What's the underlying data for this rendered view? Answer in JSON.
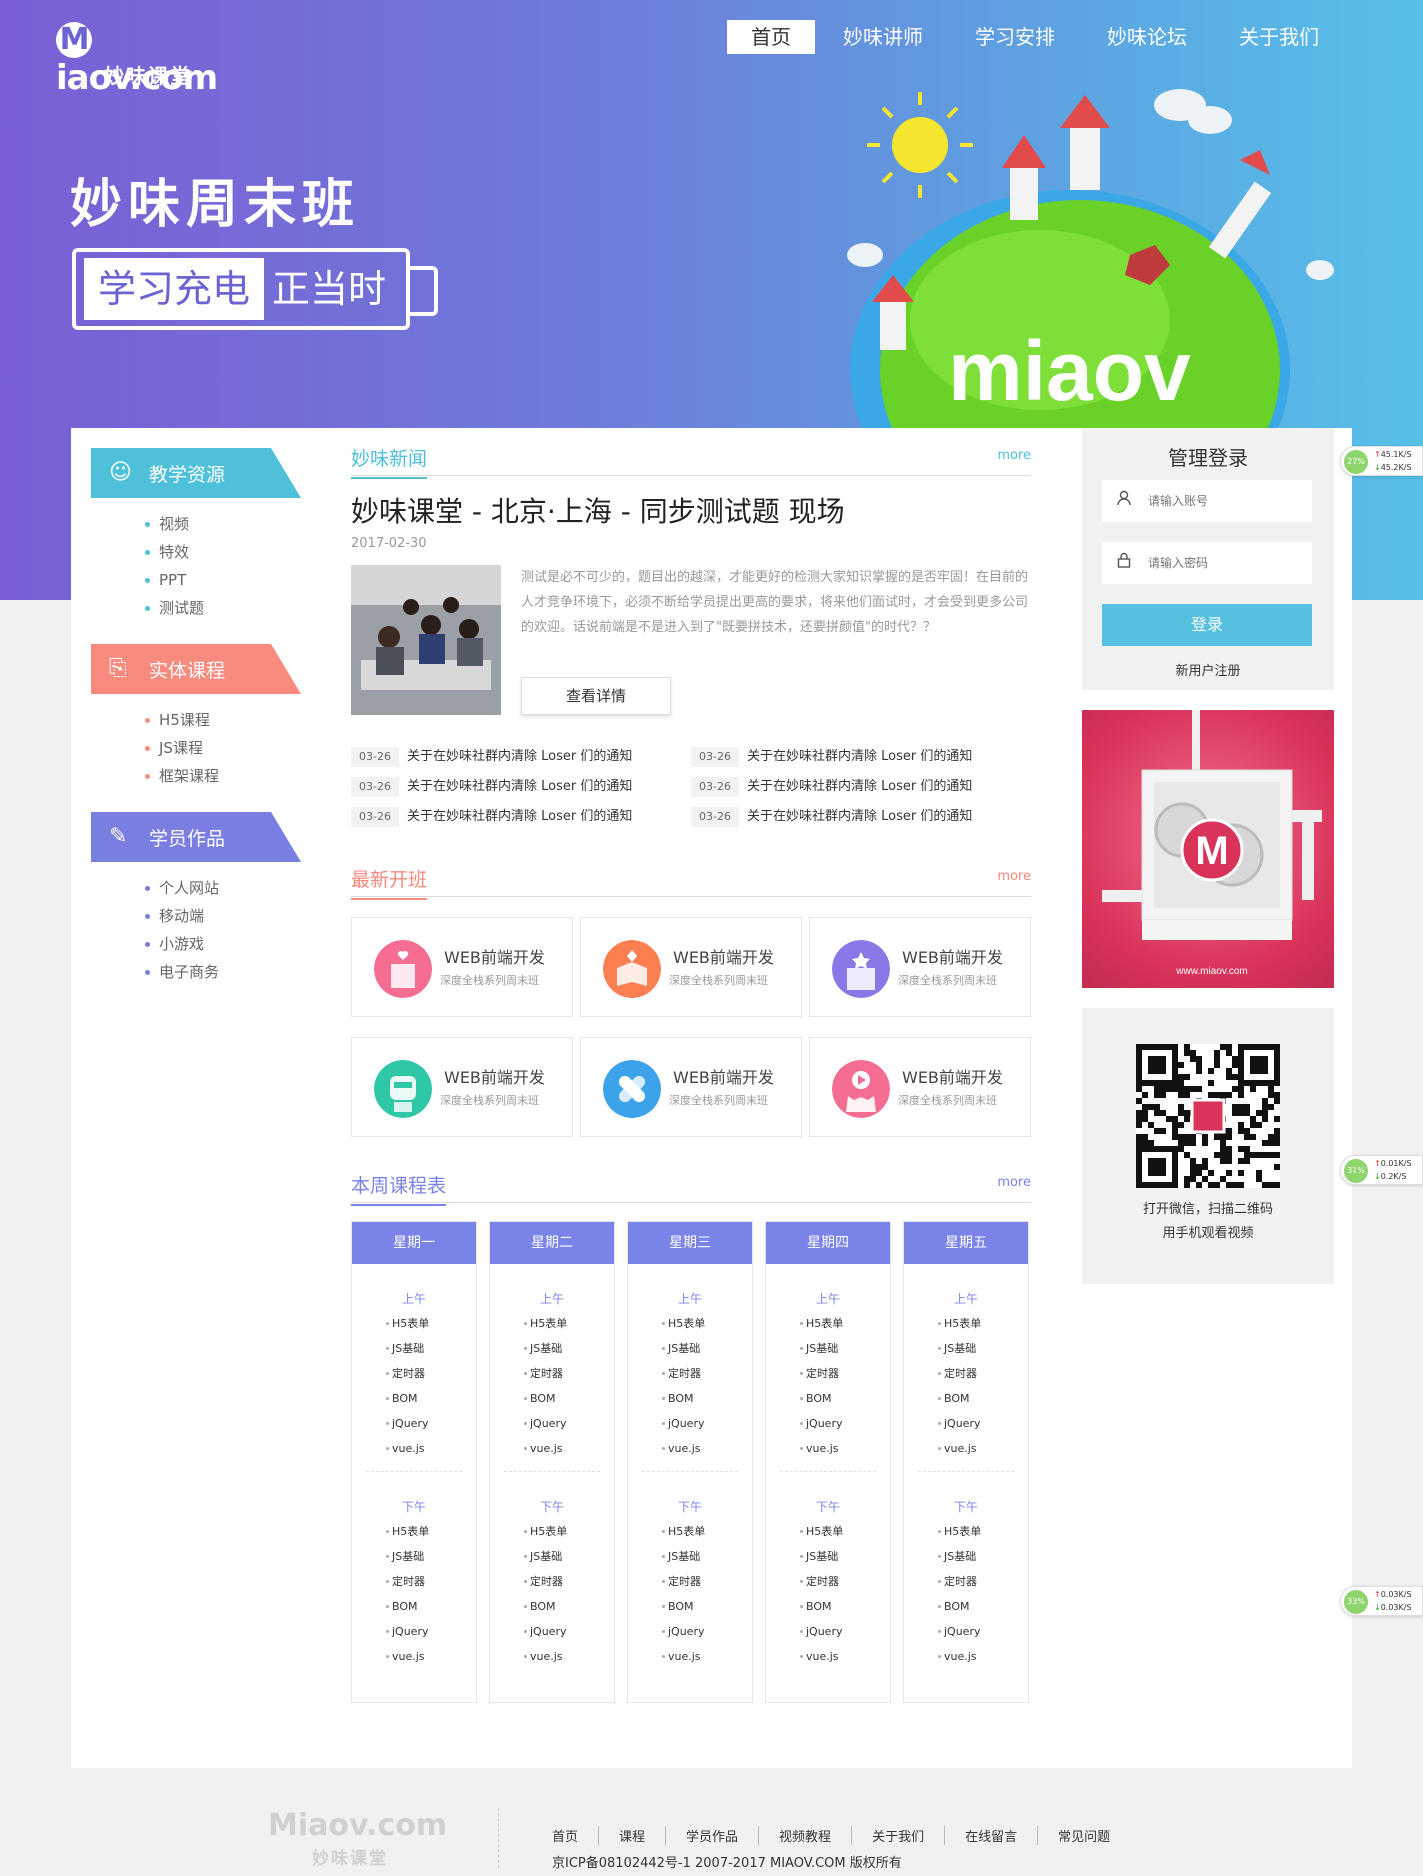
{
  "logo": {
    "main": "iaov.com",
    "m": "M",
    "sub": "妙味课堂"
  },
  "nav": [
    "首页",
    "妙味讲师",
    "学习安排",
    "妙味论坛",
    "关于我们"
  ],
  "hero": {
    "title": "妙味周末班",
    "box_highlight": "学习充电",
    "box_rest": "正当时",
    "planet_text": "miaov"
  },
  "left": {
    "cats": [
      {
        "label": "教学资源",
        "icon": "☺",
        "color": "#4fc0d9",
        "dot": "#4fc0d9",
        "items": [
          "视频",
          "特效",
          "PPT",
          "测试题"
        ]
      },
      {
        "label": "实体课程",
        "icon": "⎘",
        "color": "#f88a7e",
        "dot": "#f88a7e",
        "items": [
          "H5课程",
          "JS课程",
          "框架课程"
        ]
      },
      {
        "label": "学员作品",
        "icon": "✎",
        "color": "#7a7ee0",
        "dot": "#7a7ee0",
        "items": [
          "个人网站",
          "移动端",
          "小游戏",
          "电子商务"
        ]
      }
    ]
  },
  "news": {
    "section": "妙味新闻",
    "more": "more",
    "title": "妙味课堂 - 北京·上海 - 同步测试题 现场",
    "date": "2017-02-30",
    "summary": "测试是必不可少的，题目出的越深，才能更好的检测大家知识掌握的是否牢固！在目前的人才竞争环境下，必须不断给学员提出更高的要求，将来他们面试时，才会受到更多公司的欢迎。话说前端是不是进入到了\"既要拼技术，还要拼颜值\"的时代？？",
    "button": "查看详情",
    "list": [
      {
        "date": "03-26",
        "title": "关于在妙味社群内清除 Loser 们的通知"
      },
      {
        "date": "03-26",
        "title": "关于在妙味社群内清除 Loser 们的通知"
      },
      {
        "date": "03-26",
        "title": "关于在妙味社群内清除 Loser 们的通知"
      },
      {
        "date": "03-26",
        "title": "关于在妙味社群内清除 Loser 们的通知"
      },
      {
        "date": "03-26",
        "title": "关于在妙味社群内清除 Loser 们的通知"
      },
      {
        "date": "03-26",
        "title": "关于在妙味社群内清除 Loser 们的通知"
      }
    ]
  },
  "classes": {
    "section": "最新开班",
    "more": "more",
    "items": [
      {
        "title": "WEB前端开发",
        "sub": "深度全栈系列周末班",
        "color": "#f56d91"
      },
      {
        "title": "WEB前端开发",
        "sub": "深度全栈系列周末班",
        "color": "#fb7f51"
      },
      {
        "title": "WEB前端开发",
        "sub": "深度全栈系列周末班",
        "color": "#8a78e8"
      },
      {
        "title": "WEB前端开发",
        "sub": "深度全栈系列周末班",
        "color": "#2fc8a7"
      },
      {
        "title": "WEB前端开发",
        "sub": "深度全栈系列周末班",
        "color": "#3ca2ea"
      },
      {
        "title": "WEB前端开发",
        "sub": "深度全栈系列周末班",
        "color": "#f56d91"
      }
    ]
  },
  "schedule": {
    "section": "本周课程表",
    "more": "more",
    "days": [
      "星期一",
      "星期二",
      "星期三",
      "星期四",
      "星期五"
    ],
    "am": "上午",
    "pm": "下午",
    "topics": [
      "H5表单",
      "JS基础",
      "定时器",
      "BOM",
      "jQuery",
      "vue.js"
    ]
  },
  "login": {
    "title": "管理登录",
    "user_placeholder": "请输入账号",
    "pass_placeholder": "请输入密码",
    "button": "登录",
    "register": "新用户注册"
  },
  "ad": {
    "site": "www.miaov.com",
    "letter": "M"
  },
  "qr": {
    "line1": "打开微信，扫描二维码",
    "line2": "用手机观看视频"
  },
  "speed": [
    {
      "pct": "27%",
      "up": "45.1K/S",
      "down": "45.2K/S"
    },
    {
      "pct": "31%",
      "up": "0.01K/S",
      "down": "0.2K/S"
    },
    {
      "pct": "33%",
      "up": "0.03K/S",
      "down": "0.03K/S"
    }
  ],
  "footer": {
    "logo_main": "iaov.com",
    "logo_m": "M",
    "logo_sub": "妙味课堂",
    "links": [
      "首页",
      "课程",
      "学员作品",
      "视频教程",
      "关于我们",
      "在线留言",
      "常见问题"
    ],
    "copyright": "京ICP备08102442号-1 2007-2017 MIAOV.COM 版权所有"
  }
}
